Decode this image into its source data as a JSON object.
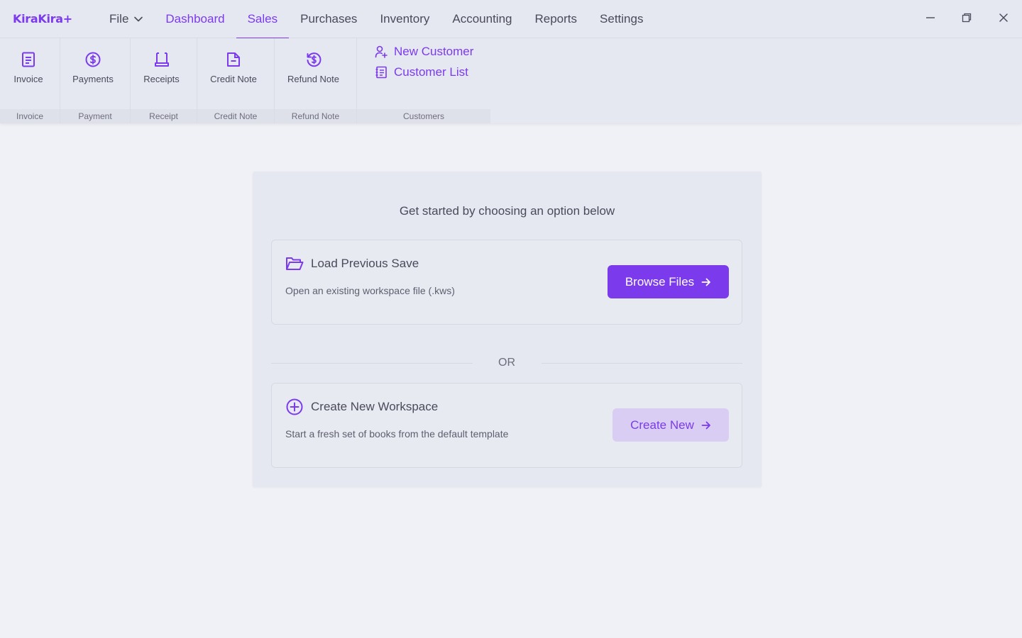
{
  "app": {
    "logo": "KiraKira+"
  },
  "menu": {
    "file": "File",
    "items": [
      "Dashboard",
      "Sales",
      "Purchases",
      "Inventory",
      "Accounting",
      "Reports",
      "Settings"
    ],
    "active": "Sales"
  },
  "window_controls": {
    "minimize_icon": "minimize-icon",
    "restore_icon": "restore-icon",
    "close_icon": "close-icon"
  },
  "ribbon": {
    "groups": [
      {
        "button": "Invoice",
        "footer": "Invoice",
        "icon": "document-icon"
      },
      {
        "button": "Payments",
        "footer": "Payment",
        "icon": "dollar-circle-icon"
      },
      {
        "button": "Receipts",
        "footer": "Receipt",
        "icon": "receipt-icon"
      },
      {
        "button": "Credit Note",
        "footer": "Credit Note",
        "icon": "document-minus-icon"
      },
      {
        "button": "Refund Note",
        "footer": "Refund Note",
        "icon": "refund-icon"
      }
    ],
    "customers": {
      "new_customer": "New Customer",
      "customer_list": "Customer List",
      "footer": "Customers"
    }
  },
  "main": {
    "heading": "Get started by choosing an option below",
    "load": {
      "title": "Load Previous Save",
      "description": "Open an existing workspace file (.kws)",
      "button": "Browse Files",
      "icon": "folder-open-icon"
    },
    "or": "OR",
    "create": {
      "title": "Create New Workspace",
      "description": "Start a fresh set of books from the default template",
      "button": "Create New",
      "icon": "plus-circle-icon"
    }
  },
  "colors": {
    "accent": "#7c3aed",
    "accent_soft": "#d9cdf3",
    "bar": "#e6e8f1",
    "background": "#f0f1f6"
  }
}
